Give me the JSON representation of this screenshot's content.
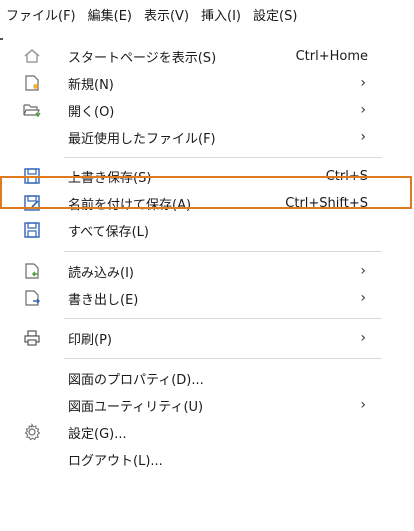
{
  "menubar": {
    "items": [
      {
        "label": "ファイル(F)"
      },
      {
        "label": "編集(E)"
      },
      {
        "label": "表示(V)"
      },
      {
        "label": "挿入(I)"
      },
      {
        "label": "設定(S)"
      }
    ]
  },
  "menu": {
    "start_page": {
      "label": "スタートページを表示(S)",
      "shortcut": "Ctrl+Home"
    },
    "new": {
      "label": "新規(N)",
      "submenu": "›"
    },
    "open": {
      "label": "開く(O)",
      "submenu": "›"
    },
    "recent": {
      "label": "最近使用したファイル(F)",
      "submenu": "›"
    },
    "save": {
      "label": "上書き保存(S)",
      "shortcut": "Ctrl+S"
    },
    "save_as": {
      "label": "名前を付けて保存(A)...",
      "shortcut": "Ctrl+Shift+S"
    },
    "save_all": {
      "label": "すべて保存(L)"
    },
    "import": {
      "label": "読み込み(I)",
      "submenu": "›"
    },
    "export": {
      "label": "書き出し(E)",
      "submenu": "›"
    },
    "print": {
      "label": "印刷(P)",
      "submenu": "›"
    },
    "properties": {
      "label": "図面のプロパティ(D)..."
    },
    "utilities": {
      "label": "図面ユーティリティ(U)",
      "submenu": "›"
    },
    "settings": {
      "label": "設定(G)..."
    },
    "logout": {
      "label": "ログアウト(L)..."
    }
  },
  "colors": {
    "highlight_border": "#e07a1f",
    "icon_blue": "#2f63b5",
    "icon_gray": "#6b6b6b",
    "icon_accent": "#f2b42c",
    "icon_green": "#4a9a3a"
  }
}
